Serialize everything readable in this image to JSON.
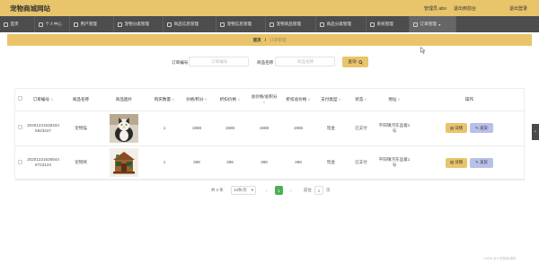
{
  "header": {
    "site_title": "宠物商城网站",
    "admin_label": "管理员 abo",
    "back_front_label": "退出到前台",
    "logout_label": "退出登录"
  },
  "nav": {
    "items": [
      {
        "label": "首页"
      },
      {
        "label": "个人中心"
      },
      {
        "label": "用户管理"
      },
      {
        "label": "宠物分类管理"
      },
      {
        "label": "商品信息管理"
      },
      {
        "label": "宠物信息管理"
      },
      {
        "label": "宠物商品管理"
      },
      {
        "label": "商品分类管理"
      },
      {
        "label": "系统管理"
      },
      {
        "label": "订单管理"
      }
    ]
  },
  "breadcrumb": {
    "home": "首页",
    "separator": "/",
    "current": "订单管理"
  },
  "search": {
    "order_no_label": "订单编号",
    "order_no_placeholder": "订单编号",
    "product_name_label": "商品名称",
    "product_name_placeholder": "商品名称",
    "query_label": "查询"
  },
  "table": {
    "headers": [
      "订单编号",
      "商品名称",
      "商品图片",
      "购买数量",
      "价格/积分",
      "折扣价格",
      "总价格/总积分",
      "折扣总价格",
      "支付类型",
      "状态",
      "地址",
      "操作"
    ],
    "rows": [
      {
        "order_no": "202012216284345823447",
        "product_name": "宠物猫",
        "quantity": "1",
        "price": "1988",
        "discount_price": "1986",
        "total": "1988",
        "discount_total": "1986",
        "pay_type": "现金",
        "status": "已支付",
        "address": "平阳镇河东品着1号",
        "image": "cat"
      },
      {
        "order_no": "202012216285448723124",
        "product_name": "宠物窝",
        "quantity": "1",
        "price": "398",
        "discount_price": "398",
        "total": "398",
        "discount_total": "398",
        "pay_type": "现金",
        "status": "已支付",
        "address": "平阳镇河东品着1号",
        "image": "pet-house"
      }
    ],
    "detail_label": "详情",
    "ship_label": "发货"
  },
  "pagination": {
    "total": "共 2 条",
    "page_size": "10条/页",
    "prev": "<",
    "current_page": "1",
    "next": ">",
    "goto_label": "前往",
    "goto_value": "1",
    "page_suffix": "页"
  },
  "watermark": "CSDN @小笠程序源码",
  "colors": {
    "header_bg": "#e8c46a",
    "nav_bg": "#4d4d4d",
    "accent": "#e9c46a",
    "ship_button": "#b8c0e8",
    "active_page": "#4caf50"
  }
}
